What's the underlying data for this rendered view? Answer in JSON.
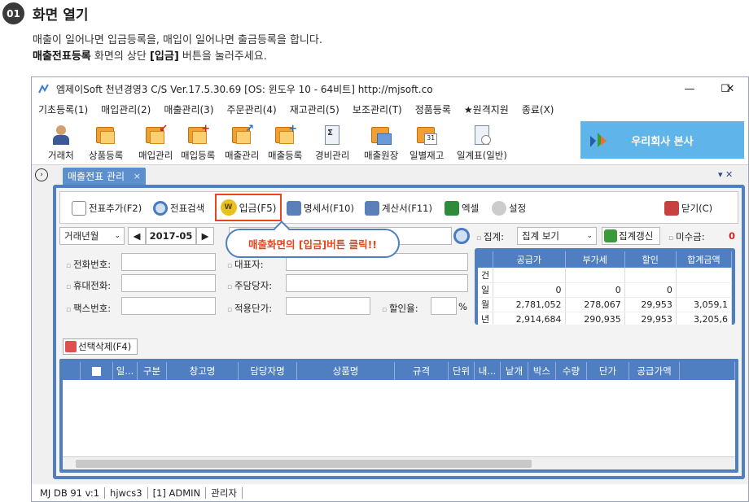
{
  "step": {
    "number": "01",
    "title": "화면 열기"
  },
  "description": {
    "line1": "매출이 일어나면 입금등록을, 매입이 일어나면 출금등록을 합니다.",
    "line2_bold1": "매출전표등록",
    "line2_mid": " 화면의 상단 ",
    "line2_bold2": "[입금]",
    "line2_end": " 버튼을 눌러주세요."
  },
  "window": {
    "title": "엠제이Soft 천년경영3 C/S   Ver.17.5.30.69   [OS: 윈도우 10 - 64비트]   http://mjsoft.co",
    "minimize": "—",
    "maximize": "☐",
    "close": "✕"
  },
  "menu": [
    "기초등록(1)",
    "매입관리(2)",
    "매출관리(3)",
    "주문관리(4)",
    "재고관리(5)",
    "보조관리(T)",
    "정품등록",
    "★원격지원",
    "종료(X)"
  ],
  "toolbar": [
    "거래처",
    "상품등록",
    "매입관리",
    "매입등록",
    "매출관리",
    "매출등록",
    "경비관리",
    "매출원장",
    "일별재고",
    "일계표(일반)"
  ],
  "company_name": "우리회사 본사",
  "doc_tab": {
    "label": "매출전표 관리",
    "close": "×"
  },
  "tab_controls": "▾ ✕",
  "form_toolbar": {
    "add_slip": "전표추가(F2)",
    "search_slip": "전표검색",
    "deposit": "입금(F5)",
    "statement": "명세서(F10)",
    "invoice": "계산서(F11)",
    "excel": "엑셀",
    "settings": "설정",
    "close": "닫기(C)"
  },
  "callout": "매출화면의 [입금]버튼 클릭!!",
  "filters": {
    "period_select": "거래년월",
    "prev": "◀",
    "month": "2017-05",
    "next": "▶",
    "aggregate_label": "집계:",
    "aggregate_select": "집계 보기",
    "refresh": "집계갱신",
    "unpaid_label": "미수금:",
    "unpaid_value": "0"
  },
  "fields": {
    "phone": "전화번호:",
    "mobile": "휴대전화:",
    "fax": "팩스번호:",
    "rep": "대표자:",
    "manager": "주담당자:",
    "unit_price": "적용단가:",
    "discount": "할인율:",
    "percent": "%"
  },
  "summary_grid": {
    "headers": [
      "",
      "공급가",
      "부가세",
      "할인",
      "합계금액"
    ],
    "rows": [
      [
        "건",
        "",
        "",
        "",
        ""
      ],
      [
        "일",
        "0",
        "0",
        "0",
        ""
      ],
      [
        "월",
        "2,781,052",
        "278,067",
        "29,953",
        "3,059,1"
      ],
      [
        "년",
        "2,914,684",
        "290,935",
        "29,953",
        "3,205,6"
      ]
    ]
  },
  "select_delete": "선택삭제(F4)",
  "list_headers": [
    "",
    "",
    "일...",
    "구분",
    "창고명",
    "담당자명",
    "상품명",
    "규격",
    "단위",
    "내...",
    "낱개",
    "박스",
    "수량",
    "단가",
    "공급가액"
  ],
  "status": [
    "MJ DB 91 v:1",
    "hjwcs3",
    "[1] ADMIN",
    "관리자"
  ]
}
